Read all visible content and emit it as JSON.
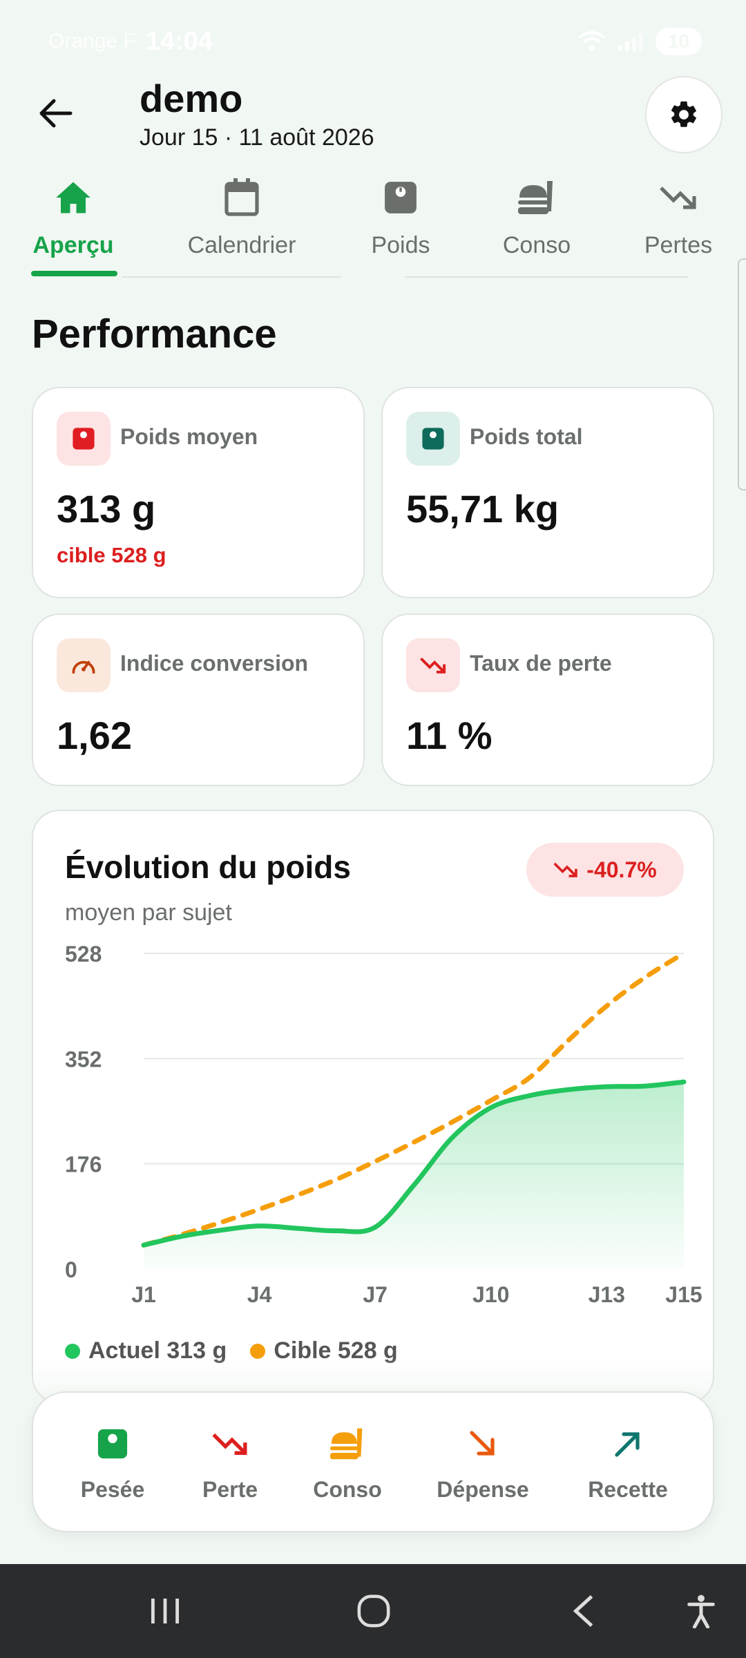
{
  "status": {
    "carrier": "Orange F",
    "time": "14:04",
    "battery": "10"
  },
  "header": {
    "title": "demo",
    "subtitle": "Jour 15 · 11 août 2026"
  },
  "tabs": [
    {
      "label": "Aperçu",
      "icon": "home-icon",
      "active": true
    },
    {
      "label": "Calendrier",
      "icon": "calendar-icon"
    },
    {
      "label": "Poids",
      "icon": "scale-icon"
    },
    {
      "label": "Conso",
      "icon": "food-icon"
    },
    {
      "label": "Pertes",
      "icon": "trending-down-icon"
    }
  ],
  "section": {
    "title": "Performance"
  },
  "metrics": [
    {
      "label": "Poids moyen",
      "value": "313 g",
      "sub": "cible 528 g",
      "icon": "scale-icon",
      "color": "#e11d24",
      "bg": "#fde3e3"
    },
    {
      "label": "Poids total",
      "value": "55,71 kg",
      "icon": "scale-icon",
      "color": "#0f6b5c",
      "bg": "#dcefeb"
    },
    {
      "label": "Indice conversion",
      "value": "1,62",
      "icon": "gauge-icon",
      "color": "#c2410c",
      "bg": "#fbe8dc"
    },
    {
      "label": "Taux de perte",
      "value": "11 %",
      "icon": "trending-down-icon",
      "color": "#dc1f1f",
      "bg": "#fde3e3"
    }
  ],
  "chart": {
    "title": "Évolution du poids",
    "subtitle": "moyen par sujet",
    "trend": "-40.7%",
    "legend": [
      {
        "label": "Actuel 313 g",
        "color": "#22c55e"
      },
      {
        "label": "Cible 528 g",
        "color": "#f59e0b"
      }
    ]
  },
  "chart_data": {
    "type": "line",
    "x": [
      "J1",
      "J2",
      "J3",
      "J4",
      "J5",
      "J6",
      "J7",
      "J8",
      "J9",
      "J10",
      "J11",
      "J12",
      "J13",
      "J14",
      "J15"
    ],
    "x_ticks": [
      "J1",
      "J4",
      "J7",
      "J10",
      "J13",
      "J15"
    ],
    "y_ticks": [
      0,
      176,
      352,
      528
    ],
    "ylim": [
      0,
      528
    ],
    "grid": true,
    "series": [
      {
        "name": "Actuel",
        "color": "#22c55e",
        "style": "solid",
        "fill": true,
        "values": [
          40,
          55,
          65,
          72,
          68,
          64,
          70,
          140,
          220,
          270,
          290,
          300,
          305,
          306,
          313
        ]
      },
      {
        "name": "Cible",
        "color": "#f59e0b",
        "style": "dashed",
        "values": [
          40,
          58,
          78,
          100,
          124,
          150,
          180,
          212,
          246,
          282,
          320,
          382,
          440,
          488,
          528
        ]
      }
    ]
  },
  "actions": [
    {
      "label": "Pesée",
      "icon": "scale-icon",
      "color": "#16a34a"
    },
    {
      "label": "Perte",
      "icon": "trending-down-icon",
      "color": "#dc1f1f"
    },
    {
      "label": "Conso",
      "icon": "food-icon",
      "color": "#f59e0b"
    },
    {
      "label": "Dépense",
      "icon": "arrow-down-right-icon",
      "color": "#ea580c"
    },
    {
      "label": "Recette",
      "icon": "arrow-up-right-icon",
      "color": "#0f766e"
    }
  ]
}
